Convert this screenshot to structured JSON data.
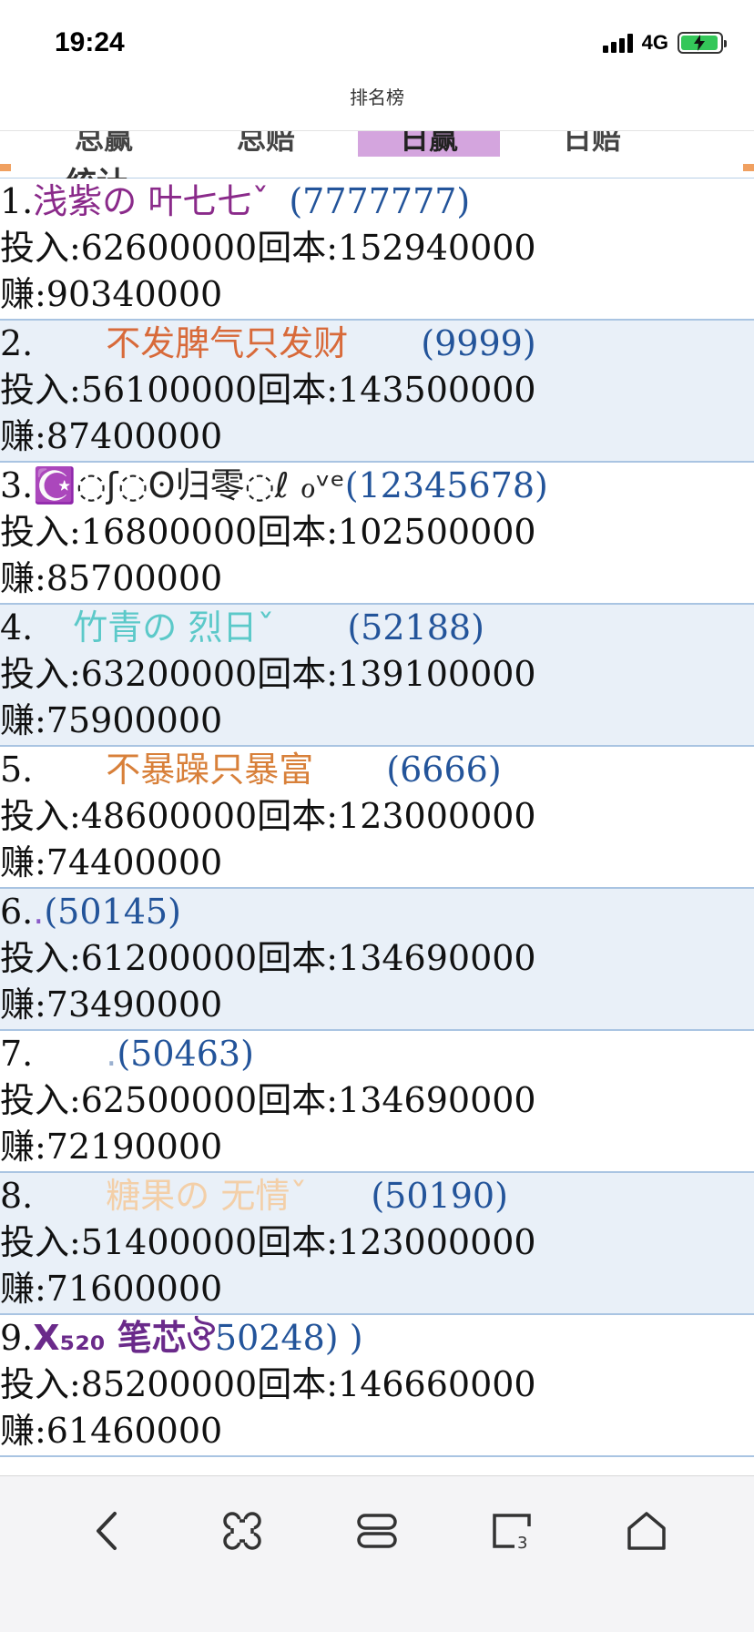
{
  "status": {
    "time": "19:24",
    "network": "4G"
  },
  "nav": {
    "title": "排名榜"
  },
  "tabs": [
    {
      "label": "总赢",
      "active": false
    },
    {
      "label": "总赔",
      "active": false
    },
    {
      "label": "日赢",
      "active": true
    },
    {
      "label": "日赔",
      "active": false
    }
  ],
  "tab_sub_label": "统计",
  "colors": {
    "active_tab": "#d4a5de",
    "uid": "#23549a",
    "row_alt": "#e9f0f8",
    "divider": "#a9c4e2"
  },
  "rows": [
    {
      "rank": "1.",
      "nick": "浅紫の 叶七七ˇ",
      "nick_color": "#8a2a8a",
      "uid": "(7777777)",
      "invest": "投入:62600000回本:152940000",
      "earn": "赚:90340000"
    },
    {
      "rank": "2.",
      "nick": "不发脾气只发财",
      "nick_color": "#d86a3a",
      "uid": "(9999)",
      "invest": "投入:56100000回本:143500000",
      "earn": "赚:87400000"
    },
    {
      "rank": "3.",
      "nick": "☪️◌ʃ◌ʘ归零◌ℓ ℴᵛᵉ",
      "nick_color": "#222222",
      "uid": "(12345678)",
      "invest": "投入:16800000回本:102500000",
      "earn": "赚:85700000"
    },
    {
      "rank": "4.",
      "nick": "竹青の 烈日ˇ",
      "nick_color": "#5cc9c9",
      "uid": "(52188)",
      "invest": "投入:63200000回本:139100000",
      "earn": "赚:75900000"
    },
    {
      "rank": "5.",
      "nick": "不暴躁只暴富",
      "nick_color": "#d8803a",
      "uid": "(6666)",
      "invest": "投入:48600000回本:123000000",
      "earn": "赚:74400000"
    },
    {
      "rank": "6.",
      "nick": ".",
      "nick_color": "#8a5ac8",
      "uid": "(50145)",
      "invest": "投入:61200000回本:134690000",
      "earn": "赚:73490000"
    },
    {
      "rank": "7.",
      "nick": ".",
      "nick_color": "#9ab0d0",
      "uid": "(50463)",
      "invest": "投入:62500000回本:134690000",
      "earn": "赚:72190000"
    },
    {
      "rank": "8.",
      "nick": "糖果の 无情ˇ",
      "nick_color": "#f3cfa8",
      "uid": "(50190)",
      "invest": "投入:51400000回本:123000000",
      "earn": "赚:71600000"
    },
    {
      "rank": "9.",
      "nick": "X₅₂₀ 笔芯ঔ",
      "nick_color": "#6a2a8a",
      "uid": "50248) )",
      "invest": "投入:85200000回本:146660000",
      "earn": "赚:61460000"
    }
  ],
  "bottom_nav": [
    {
      "icon": "back-chevron-icon"
    },
    {
      "icon": "command-icon"
    },
    {
      "icon": "tabs-stack-icon"
    },
    {
      "icon": "window-count-icon"
    },
    {
      "icon": "home-icon"
    }
  ]
}
